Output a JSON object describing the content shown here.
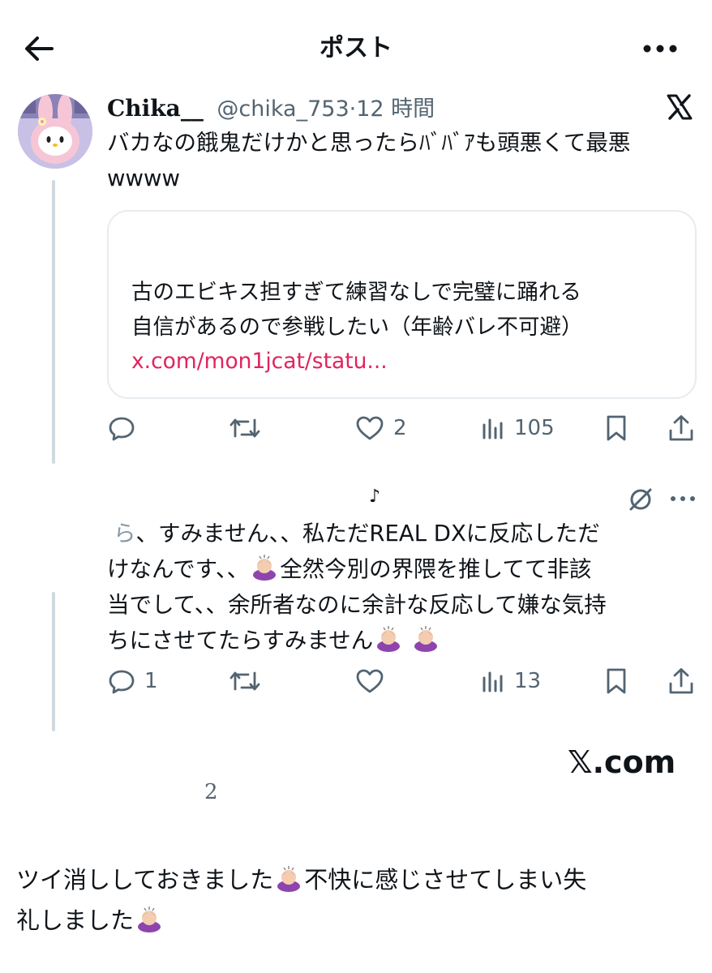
{
  "header": {
    "title": "ポスト",
    "back_icon": "arrow-left-icon",
    "more_icon": "more-horizontal-icon"
  },
  "main_tweet": {
    "display_name": "Chika__",
    "handle": "@chika_753",
    "separator": "·",
    "time": "12 時間",
    "text_line1": "バカなの餓鬼だけかと思ったらﾊﾞﾊﾞｱも頭悪くて最悪",
    "text_line2": "wwww",
    "quote": {
      "line1": "古のエビキス担すぎて練習なしで完璧に踊れる",
      "line2": "自信があるので参戦したい（年齢バレ不可避）",
      "link": "x.com/mon1jcat/statu..."
    },
    "actions": {
      "replies": "",
      "retweets": "",
      "likes": "2",
      "views": "105"
    }
  },
  "reply_tweet": {
    "note": "♪",
    "line1": "、すみません、、私ただREAL DXに反応しただ",
    "line1_prefix": "ら",
    "line2_a": "けなんです、、",
    "line2_b": "全然今別の界隈を推してて非該",
    "line3": "当でして、、余所者なのに余計な反応して嫌な気持",
    "line4": "ちにさせてたらすみません",
    "actions": {
      "replies": "1",
      "retweets": "",
      "likes": "",
      "views": "13"
    }
  },
  "watermark": "𝕏.com",
  "stray_number": "2",
  "bottom_note": {
    "line1_a": "ツイ消ししておきました",
    "line1_b": "不快に感じさせてしまい失",
    "line2": "礼しました"
  },
  "colors": {
    "link": "#e0245e",
    "secondary": "#536471",
    "border": "#e6ecf0"
  }
}
